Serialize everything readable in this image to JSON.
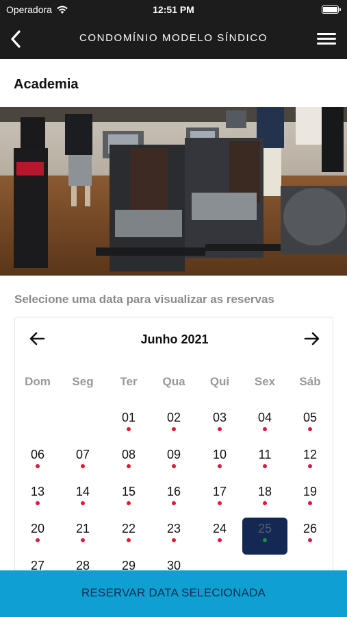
{
  "status_bar": {
    "carrier": "Operadora",
    "time": "12:51 PM"
  },
  "nav": {
    "title": "CONDOMÍNIO MODELO SÍNDICO"
  },
  "page": {
    "section_title": "Academia",
    "hint": "Selecione uma data para visualizar as reservas"
  },
  "calendar": {
    "month_label": "Junho 2021",
    "weekdays": [
      "Dom",
      "Seg",
      "Ter",
      "Qua",
      "Qui",
      "Sex",
      "Sáb"
    ],
    "selected_day": "25",
    "days": [
      {
        "label": "01",
        "col": 2,
        "week": 0,
        "dot": true
      },
      {
        "label": "02",
        "col": 3,
        "week": 0,
        "dot": true
      },
      {
        "label": "03",
        "col": 4,
        "week": 0,
        "dot": true
      },
      {
        "label": "04",
        "col": 5,
        "week": 0,
        "dot": true
      },
      {
        "label": "05",
        "col": 6,
        "week": 0,
        "dot": true
      },
      {
        "label": "06",
        "col": 0,
        "week": 1,
        "dot": true
      },
      {
        "label": "07",
        "col": 1,
        "week": 1,
        "dot": true
      },
      {
        "label": "08",
        "col": 2,
        "week": 1,
        "dot": true
      },
      {
        "label": "09",
        "col": 3,
        "week": 1,
        "dot": true
      },
      {
        "label": "10",
        "col": 4,
        "week": 1,
        "dot": true
      },
      {
        "label": "11",
        "col": 5,
        "week": 1,
        "dot": true
      },
      {
        "label": "12",
        "col": 6,
        "week": 1,
        "dot": true
      },
      {
        "label": "13",
        "col": 0,
        "week": 2,
        "dot": true
      },
      {
        "label": "14",
        "col": 1,
        "week": 2,
        "dot": true
      },
      {
        "label": "15",
        "col": 2,
        "week": 2,
        "dot": true
      },
      {
        "label": "16",
        "col": 3,
        "week": 2,
        "dot": true
      },
      {
        "label": "17",
        "col": 4,
        "week": 2,
        "dot": true
      },
      {
        "label": "18",
        "col": 5,
        "week": 2,
        "dot": true
      },
      {
        "label": "19",
        "col": 6,
        "week": 2,
        "dot": true
      },
      {
        "label": "20",
        "col": 0,
        "week": 3,
        "dot": true
      },
      {
        "label": "21",
        "col": 1,
        "week": 3,
        "dot": true
      },
      {
        "label": "22",
        "col": 2,
        "week": 3,
        "dot": true
      },
      {
        "label": "23",
        "col": 3,
        "week": 3,
        "dot": true
      },
      {
        "label": "24",
        "col": 4,
        "week": 3,
        "dot": true
      },
      {
        "label": "25",
        "col": 5,
        "week": 3,
        "dot": true
      },
      {
        "label": "26",
        "col": 6,
        "week": 3,
        "dot": true
      },
      {
        "label": "27",
        "col": 0,
        "week": 4,
        "dot": false
      },
      {
        "label": "28",
        "col": 1,
        "week": 4,
        "dot": false
      },
      {
        "label": "29",
        "col": 2,
        "week": 4,
        "dot": false
      },
      {
        "label": "30",
        "col": 3,
        "week": 4,
        "dot": false
      }
    ]
  },
  "actions": {
    "reserve_label": "RESERVAR DATA SELECIONADA"
  },
  "colors": {
    "nav_background": "#1c1c1c",
    "reservation_dot": "#e8173a",
    "selected_day_background": "#132853",
    "selected_day_dot": "#1d8a46",
    "reserve_button": "#0fa0d2"
  },
  "icons": {
    "back": "chevron-left-icon",
    "menu": "hamburger-menu-icon",
    "prev_month": "arrow-left-icon",
    "next_month": "arrow-right-icon",
    "wifi": "wifi-icon",
    "battery": "battery-icon"
  }
}
